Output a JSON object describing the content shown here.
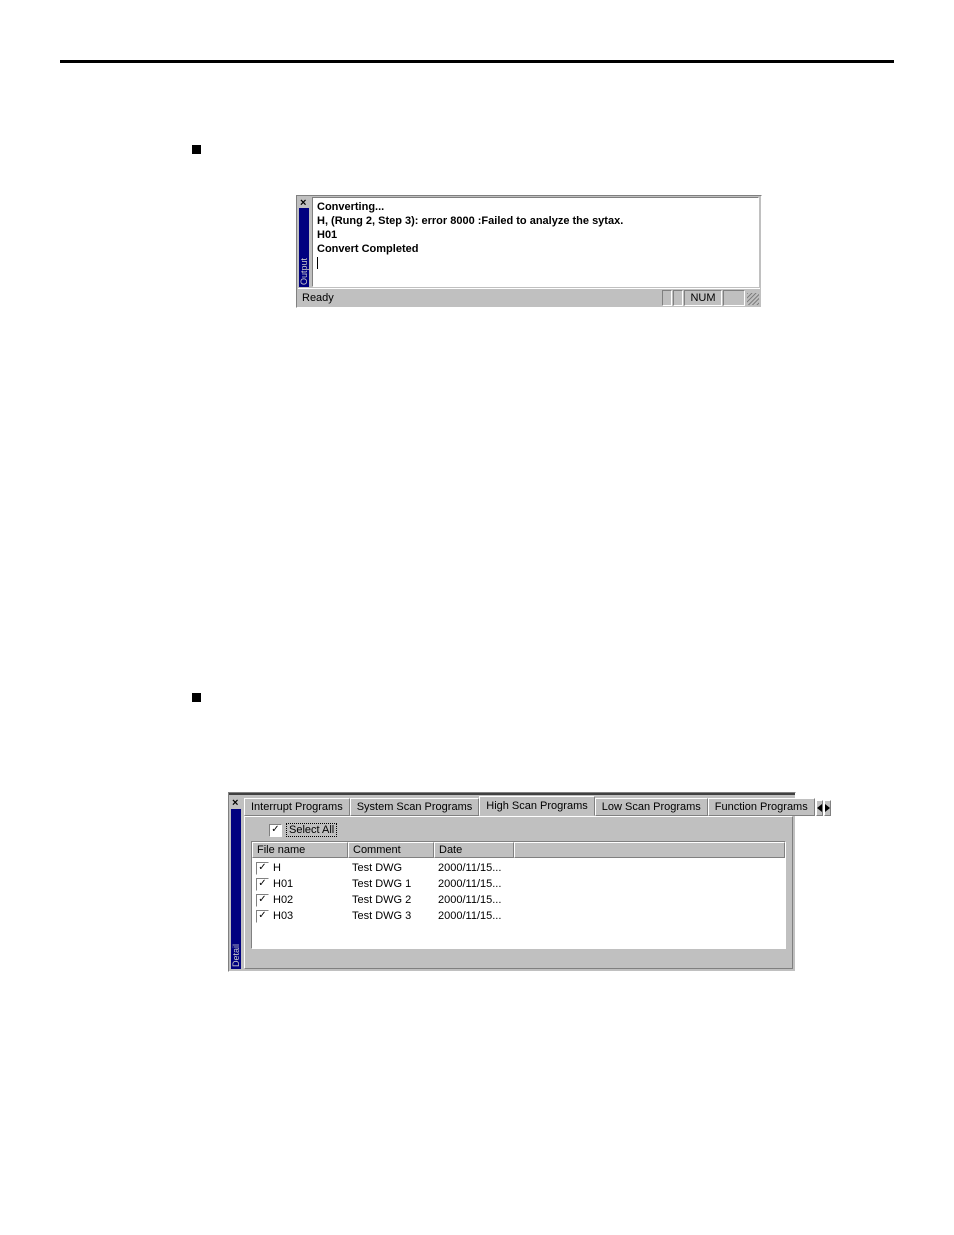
{
  "output_panel": {
    "strip_label": "Output",
    "lines": [
      "Converting...",
      "H, (Rung 2, Step 3): error 8000 :Failed to analyze the sytax.",
      "H01",
      "Convert Completed"
    ],
    "status_ready": "Ready",
    "status_num": "NUM"
  },
  "detail_panel": {
    "strip_label": "Detail",
    "tabs": [
      "Interrupt Programs",
      "System Scan Programs",
      "High Scan Programs",
      "Low Scan Programs",
      "Function Programs"
    ],
    "active_tab_index": 2,
    "select_all_label": "Select All",
    "select_all_checked": true,
    "columns": {
      "file": "File name",
      "comment": "Comment",
      "date": "Date"
    },
    "rows": [
      {
        "checked": true,
        "file": "H",
        "comment": "Test DWG",
        "date": "2000/11/15..."
      },
      {
        "checked": true,
        "file": "H01",
        "comment": "Test DWG 1",
        "date": "2000/11/15..."
      },
      {
        "checked": true,
        "file": "H02",
        "comment": "Test DWG 2",
        "date": "2000/11/15..."
      },
      {
        "checked": true,
        "file": "H03",
        "comment": "Test DWG 3",
        "date": "2000/11/15..."
      }
    ]
  }
}
